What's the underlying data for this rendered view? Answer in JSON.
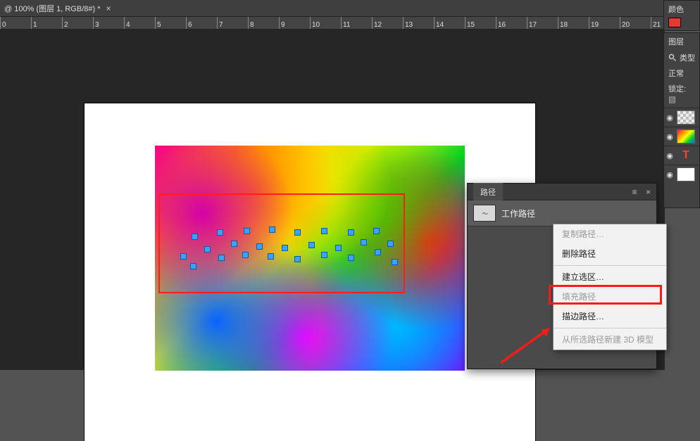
{
  "document": {
    "tab_title": "@ 100% (图层 1, RGB/8#) *"
  },
  "ruler": {
    "marks": [
      0,
      1,
      2,
      3,
      4,
      5,
      6,
      7,
      8,
      9,
      10,
      11,
      12,
      13,
      14,
      15,
      16,
      17,
      18,
      19,
      20,
      21
    ]
  },
  "panels": {
    "color": {
      "title": "颜色",
      "current_hex": "#e53b2f"
    },
    "layers": {
      "title": "图层",
      "filter_label": "类型",
      "blend_mode": "正常",
      "lock_label": "锁定:",
      "layers": [
        {
          "id": "layer-1",
          "visible": true,
          "thumb": "checker"
        },
        {
          "id": "layer-2",
          "visible": true,
          "thumb": "splashmini"
        },
        {
          "id": "layer-3",
          "visible": true,
          "thumb": "textT",
          "text_char": "T"
        },
        {
          "id": "layer-4",
          "visible": true,
          "thumb": "white"
        }
      ]
    }
  },
  "paths_panel": {
    "tab_label": "路径",
    "item_name": "工作路径"
  },
  "context_menu": {
    "duplicate": "复制路径…",
    "delete": "删除路径",
    "make_selection": "建立选区…",
    "fill_path": "填充路径",
    "stroke_path": "描边路径…",
    "new_3d": "从所选路径新建 3D 模型"
  },
  "icons": {
    "eye": "◉",
    "search": "search-icon"
  }
}
